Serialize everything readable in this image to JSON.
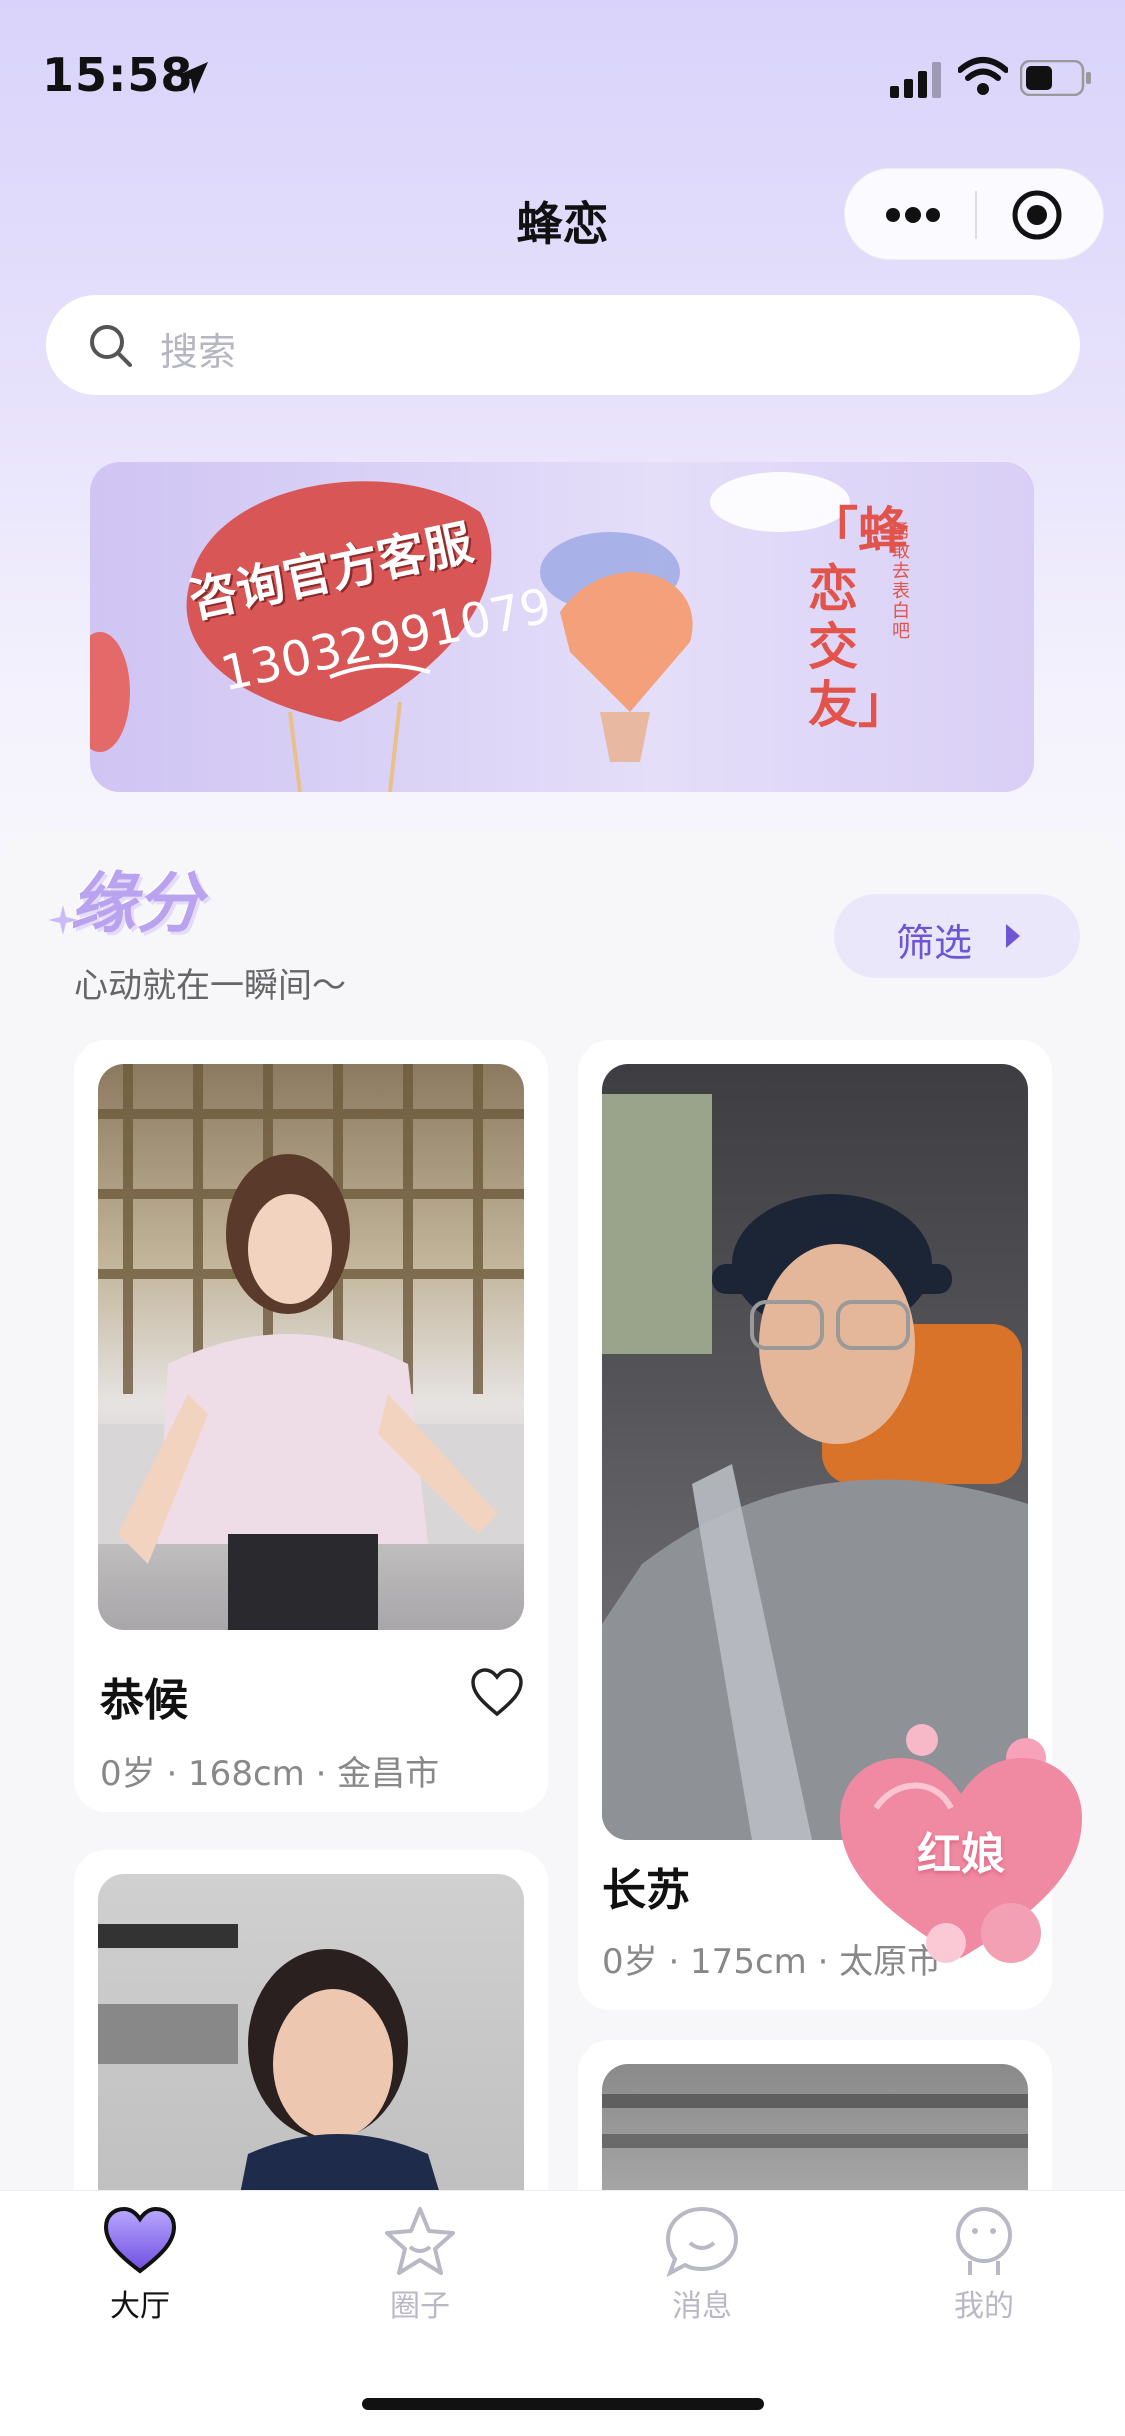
{
  "status_bar": {
    "time": "15:58"
  },
  "nav": {
    "title": "蜂恋"
  },
  "search": {
    "placeholder": "搜索"
  },
  "banner": {
    "heart_line1": "咨询官方客服",
    "heart_line2": "13032991079",
    "slogan": "「蜂恋交友」",
    "side_text": "勇敢去表白吧"
  },
  "section": {
    "title": "缘分",
    "subtitle": "心动就在一瞬间～",
    "filter_label": "筛选"
  },
  "profiles": [
    {
      "name": "恭候",
      "info": "0岁 · 168cm · 金昌市"
    },
    {
      "name": "长苏",
      "info": "0岁 · 175cm · 太原市"
    }
  ],
  "matchmaker": {
    "label": "红娘"
  },
  "tabs": [
    {
      "label": "大厅",
      "active": true
    },
    {
      "label": "圈子",
      "active": false
    },
    {
      "label": "消息",
      "active": false
    },
    {
      "label": "我的",
      "active": false
    }
  ],
  "colors": {
    "accent": "#6d56d3",
    "tab_inactive": "#b9b9c6",
    "brand_light": "#ebe7fb"
  }
}
